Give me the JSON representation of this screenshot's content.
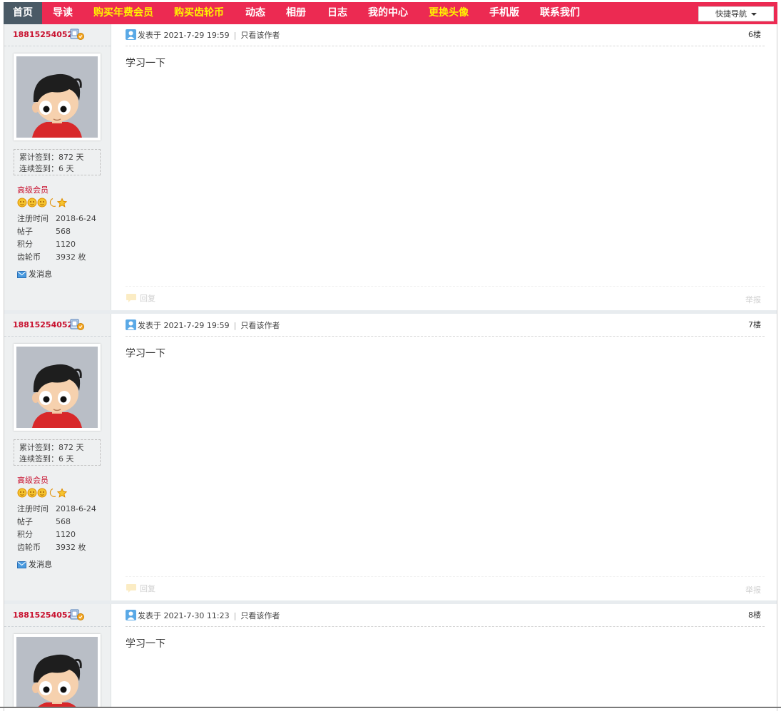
{
  "nav": {
    "items": [
      {
        "label": "首页"
      },
      {
        "label": "导读"
      },
      {
        "label": "购买年费会员"
      },
      {
        "label": "购买齿轮币"
      },
      {
        "label": "动态"
      },
      {
        "label": "相册"
      },
      {
        "label": "日志"
      },
      {
        "label": "我的中心"
      },
      {
        "label": "更换头像"
      },
      {
        "label": "手机版"
      },
      {
        "label": "联系我们"
      }
    ],
    "quick_nav": "快捷导航"
  },
  "colors": {
    "navbar": "#ec2a52",
    "active_tab": "#4a5a66",
    "highlight": "#fff200",
    "username": "#c8102e"
  },
  "posts": [
    {
      "author": "18815254052",
      "sign_total": "累计签到：872 天",
      "sign_streak": "连续签到：6 天",
      "level": "高级会员",
      "info": [
        {
          "k": "注册时间",
          "v": "2018-6-24"
        },
        {
          "k": "帖子",
          "v": "568"
        },
        {
          "k": "积分",
          "v": "1120"
        },
        {
          "k": "齿轮币",
          "v": "3932 枚"
        }
      ],
      "send_msg": "发消息",
      "posted": "发表于 2021-7-29 19:59",
      "only_author": "只看该作者",
      "floor": "6楼",
      "content": "学习一下",
      "reply": "回复",
      "report": "举报"
    },
    {
      "author": "18815254052",
      "sign_total": "累计签到：872 天",
      "sign_streak": "连续签到：6 天",
      "level": "高级会员",
      "info": [
        {
          "k": "注册时间",
          "v": "2018-6-24"
        },
        {
          "k": "帖子",
          "v": "568"
        },
        {
          "k": "积分",
          "v": "1120"
        },
        {
          "k": "齿轮币",
          "v": "3932 枚"
        }
      ],
      "send_msg": "发消息",
      "posted": "发表于 2021-7-29 19:59",
      "only_author": "只看该作者",
      "floor": "7楼",
      "content": "学习一下",
      "reply": "回复",
      "report": "举报"
    },
    {
      "author": "18815254052",
      "posted": "发表于 2021-7-30 11:23",
      "only_author": "只看该作者",
      "floor": "8楼",
      "content": "学习一下"
    }
  ]
}
